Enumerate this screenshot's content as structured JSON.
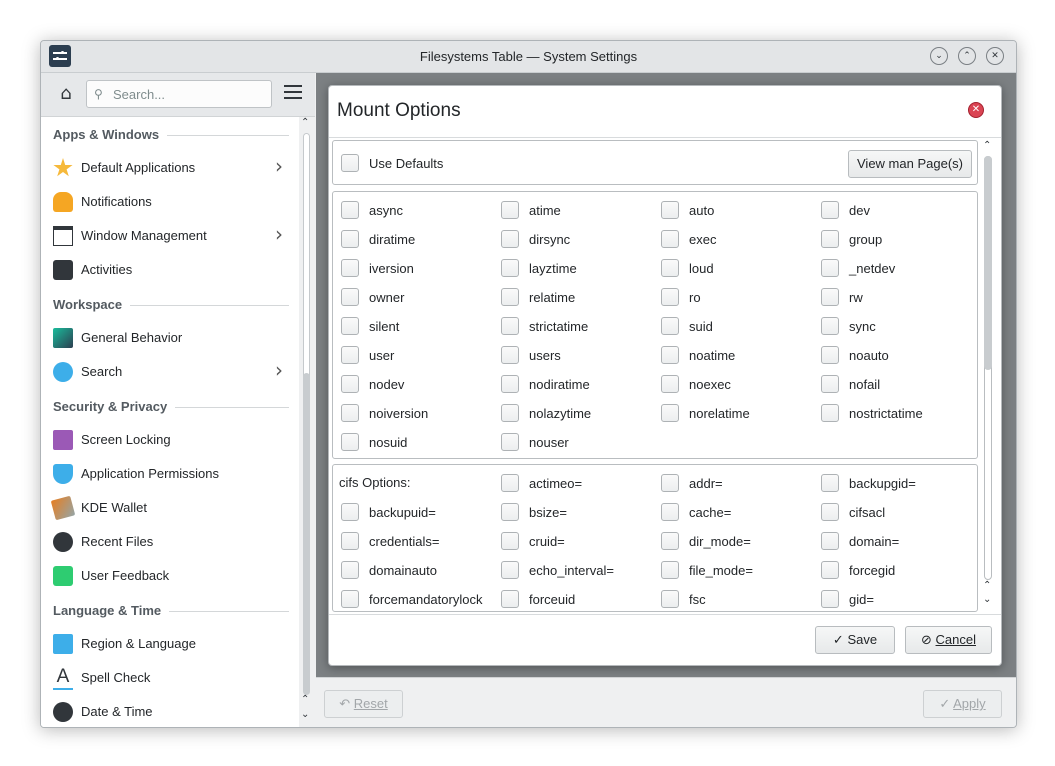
{
  "window": {
    "title": "Filesystems Table — System Settings"
  },
  "titlebar_buttons": [
    "minimize-icon",
    "maximize-icon",
    "close-icon"
  ],
  "sidebar": {
    "search_placeholder": "Search...",
    "sections": [
      {
        "header": "Apps & Windows",
        "items": [
          {
            "label": "Default Applications",
            "icon": "star-icon",
            "chevron": true
          },
          {
            "label": "Notifications",
            "icon": "bell-icon",
            "chevron": false
          },
          {
            "label": "Window Management",
            "icon": "window-icon",
            "chevron": true
          },
          {
            "label": "Activities",
            "icon": "activities-icon",
            "chevron": false
          }
        ]
      },
      {
        "header": "Workspace",
        "items": [
          {
            "label": "General Behavior",
            "icon": "general-behavior-icon",
            "chevron": false
          },
          {
            "label": "Search",
            "icon": "magnifier-icon",
            "chevron": true
          }
        ]
      },
      {
        "header": "Security & Privacy",
        "items": [
          {
            "label": "Screen Locking",
            "icon": "lock-screen-icon",
            "chevron": false
          },
          {
            "label": "Application Permissions",
            "icon": "shield-icon",
            "chevron": false
          },
          {
            "label": "KDE Wallet",
            "icon": "wallet-icon",
            "chevron": false
          },
          {
            "label": "Recent Files",
            "icon": "clock-icon",
            "chevron": false
          },
          {
            "label": "User Feedback",
            "icon": "feedback-icon",
            "chevron": false
          }
        ]
      },
      {
        "header": "Language & Time",
        "items": [
          {
            "label": "Region & Language",
            "icon": "region-icon",
            "chevron": false
          },
          {
            "label": "Spell Check",
            "icon": "spell-check-icon",
            "chevron": false
          },
          {
            "label": "Date & Time",
            "icon": "clock-icon",
            "chevron": false
          }
        ]
      }
    ]
  },
  "bottom": {
    "reset_label": "Reset",
    "apply_label": "Apply"
  },
  "dialog": {
    "title": "Mount Options",
    "use_defaults": "Use Defaults",
    "man_button": "View man Page(s)",
    "options": [
      "async",
      "atime",
      "auto",
      "dev",
      "diratime",
      "dirsync",
      "exec",
      "group",
      "iversion",
      "layztime",
      "loud",
      "_netdev",
      "owner",
      "relatime",
      "ro",
      "rw",
      "silent",
      "strictatime",
      "suid",
      "sync",
      "user",
      "users",
      "noatime",
      "noauto",
      "nodev",
      "nodiratime",
      "noexec",
      "nofail",
      "noiversion",
      "nolazytime",
      "norelatime",
      "nostrictatime",
      "nosuid",
      "nouser"
    ],
    "cifs_label": "cifs Options:",
    "cifs_options": [
      "actimeo=",
      "addr=",
      "backupgid=",
      "backupuid=",
      "bsize=",
      "cache=",
      "cifsacl",
      "credentials=",
      "cruid=",
      "dir_mode=",
      "domain=",
      "domainauto",
      "echo_interval=",
      "file_mode=",
      "forcegid",
      "forcemandatorylock",
      "forceuid",
      "fsc",
      "gid="
    ],
    "save_label": "Save",
    "cancel_label": "Cancel"
  },
  "colors": {
    "accent": "#3daee9",
    "close_red": "#da4453",
    "dim_overlay": "#7c8083"
  }
}
